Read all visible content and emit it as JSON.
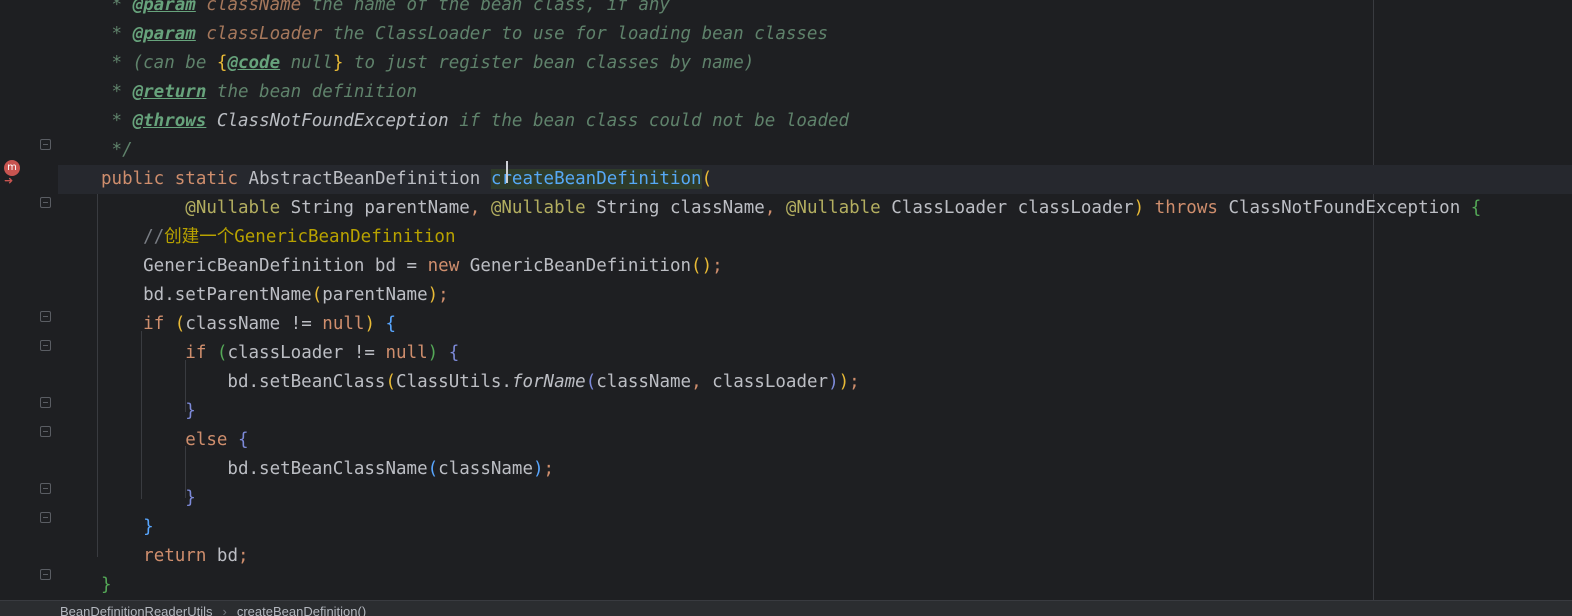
{
  "editor": {
    "gutter": {
      "method_icon": "method-marker-icon",
      "method_glyph": "m",
      "override_arrow_glyph": "➜"
    },
    "lines": [
      [
        {
          "t": " * ",
          "c": "c-doc"
        },
        {
          "t": "@param",
          "c": "c-doctag"
        },
        {
          "t": " ",
          "c": "c-doc"
        },
        {
          "t": "className",
          "c": "c-docparam"
        },
        {
          "t": " the name of the bean class, if any",
          "c": "c-doc"
        }
      ],
      [
        {
          "t": " * ",
          "c": "c-doc"
        },
        {
          "t": "@param",
          "c": "c-doctag"
        },
        {
          "t": " ",
          "c": "c-doc"
        },
        {
          "t": "classLoader",
          "c": "c-docparam"
        },
        {
          "t": " the ClassLoader to use for loading bean classes",
          "c": "c-doc"
        }
      ],
      [
        {
          "t": " * (can be ",
          "c": "c-doc"
        },
        {
          "t": "{",
          "c": "c-p1"
        },
        {
          "t": "@code",
          "c": "c-doctag"
        },
        {
          "t": " null",
          "c": "c-doc"
        },
        {
          "t": "}",
          "c": "c-p1"
        },
        {
          "t": " to just register bean classes by name)",
          "c": "c-doc"
        }
      ],
      [
        {
          "t": " * ",
          "c": "c-doc"
        },
        {
          "t": "@return",
          "c": "c-doctag"
        },
        {
          "t": " the bean definition",
          "c": "c-doc"
        }
      ],
      [
        {
          "t": " * ",
          "c": "c-doc"
        },
        {
          "t": "@throws",
          "c": "c-doctag"
        },
        {
          "t": " ",
          "c": "c-doc"
        },
        {
          "t": "ClassNotFoundException",
          "c": "c-docref"
        },
        {
          "t": " if the bean class could not be loaded",
          "c": "c-doc"
        }
      ],
      [
        {
          "t": " */",
          "c": "c-doc"
        }
      ],
      [
        {
          "t": "public ",
          "c": "c-kw"
        },
        {
          "t": "static ",
          "c": "c-kw"
        },
        {
          "t": "AbstractBeanDefinition ",
          "c": "c-def"
        },
        {
          "t": "createBeanDefinition",
          "c": "c-fnhl"
        },
        {
          "t": "(",
          "c": "c-p1"
        }
      ],
      [
        {
          "t": "        ",
          "c": "c-def"
        },
        {
          "t": "@Nullable",
          "c": "c-ann"
        },
        {
          "t": " String parentName",
          "c": "c-def"
        },
        {
          "t": ", ",
          "c": "c-sep"
        },
        {
          "t": "@Nullable",
          "c": "c-ann"
        },
        {
          "t": " String className",
          "c": "c-def"
        },
        {
          "t": ", ",
          "c": "c-sep"
        },
        {
          "t": "@Nullable",
          "c": "c-ann"
        },
        {
          "t": " ClassLoader classLoader",
          "c": "c-def"
        },
        {
          "t": ")",
          "c": "c-p1"
        },
        {
          "t": " throws ",
          "c": "c-kw"
        },
        {
          "t": "ClassNotFoundException ",
          "c": "c-def"
        },
        {
          "t": "{",
          "c": "c-p4"
        }
      ],
      [
        {
          "t": "    ",
          "c": "c-def"
        },
        {
          "t": "//",
          "c": "c-cmt"
        },
        {
          "t": "创建一个GenericBeanDefinition",
          "c": "c-cmt-cn"
        }
      ],
      [
        {
          "t": "    GenericBeanDefinition bd = ",
          "c": "c-def"
        },
        {
          "t": "new ",
          "c": "c-kw"
        },
        {
          "t": "GenericBeanDefinition",
          "c": "c-def"
        },
        {
          "t": "()",
          "c": "c-p1"
        },
        {
          "t": ";",
          "c": "c-sep"
        }
      ],
      [
        {
          "t": "    bd.setParentName",
          "c": "c-def"
        },
        {
          "t": "(",
          "c": "c-p1"
        },
        {
          "t": "parentName",
          "c": "c-def"
        },
        {
          "t": ")",
          "c": "c-p1"
        },
        {
          "t": ";",
          "c": "c-sep"
        }
      ],
      [
        {
          "t": "    ",
          "c": "c-def"
        },
        {
          "t": "if ",
          "c": "c-kw"
        },
        {
          "t": "(",
          "c": "c-p1"
        },
        {
          "t": "className != ",
          "c": "c-def"
        },
        {
          "t": "null",
          "c": "c-kw"
        },
        {
          "t": ") ",
          "c": "c-p1"
        },
        {
          "t": "{",
          "c": "c-p2"
        }
      ],
      [
        {
          "t": "        ",
          "c": "c-def"
        },
        {
          "t": "if ",
          "c": "c-kw"
        },
        {
          "t": "(",
          "c": "c-p4"
        },
        {
          "t": "classLoader != ",
          "c": "c-def"
        },
        {
          "t": "null",
          "c": "c-kw"
        },
        {
          "t": ") ",
          "c": "c-p4"
        },
        {
          "t": "{",
          "c": "c-p3"
        }
      ],
      [
        {
          "t": "            bd.setBeanClass",
          "c": "c-def"
        },
        {
          "t": "(",
          "c": "c-p1"
        },
        {
          "t": "ClassUtils.",
          "c": "c-def"
        },
        {
          "t": "forName",
          "c": "c-static"
        },
        {
          "t": "(",
          "c": "c-p3"
        },
        {
          "t": "className",
          "c": "c-def"
        },
        {
          "t": ", ",
          "c": "c-sep"
        },
        {
          "t": "classLoader",
          "c": "c-def"
        },
        {
          "t": ")",
          "c": "c-p3"
        },
        {
          "t": ")",
          "c": "c-p1"
        },
        {
          "t": ";",
          "c": "c-sep"
        }
      ],
      [
        {
          "t": "        ",
          "c": "c-def"
        },
        {
          "t": "}",
          "c": "c-p3"
        }
      ],
      [
        {
          "t": "        ",
          "c": "c-def"
        },
        {
          "t": "else ",
          "c": "c-kw"
        },
        {
          "t": "{",
          "c": "c-p3"
        }
      ],
      [
        {
          "t": "            bd.setBeanClassName",
          "c": "c-def"
        },
        {
          "t": "(",
          "c": "c-p2"
        },
        {
          "t": "className",
          "c": "c-def"
        },
        {
          "t": ")",
          "c": "c-p2"
        },
        {
          "t": ";",
          "c": "c-sep"
        }
      ],
      [
        {
          "t": "        ",
          "c": "c-def"
        },
        {
          "t": "}",
          "c": "c-p3"
        }
      ],
      [
        {
          "t": "    ",
          "c": "c-def"
        },
        {
          "t": "}",
          "c": "c-p2"
        }
      ],
      [
        {
          "t": "    ",
          "c": "c-def"
        },
        {
          "t": "return ",
          "c": "c-kw"
        },
        {
          "t": "bd",
          "c": "c-def"
        },
        {
          "t": ";",
          "c": "c-sep"
        }
      ],
      [
        {
          "t": "}",
          "c": "c-p4"
        }
      ]
    ]
  },
  "breadcrumb": {
    "items": [
      "BeanDefinitionReaderUtils",
      "createBeanDefinition()"
    ],
    "separator": "›"
  }
}
